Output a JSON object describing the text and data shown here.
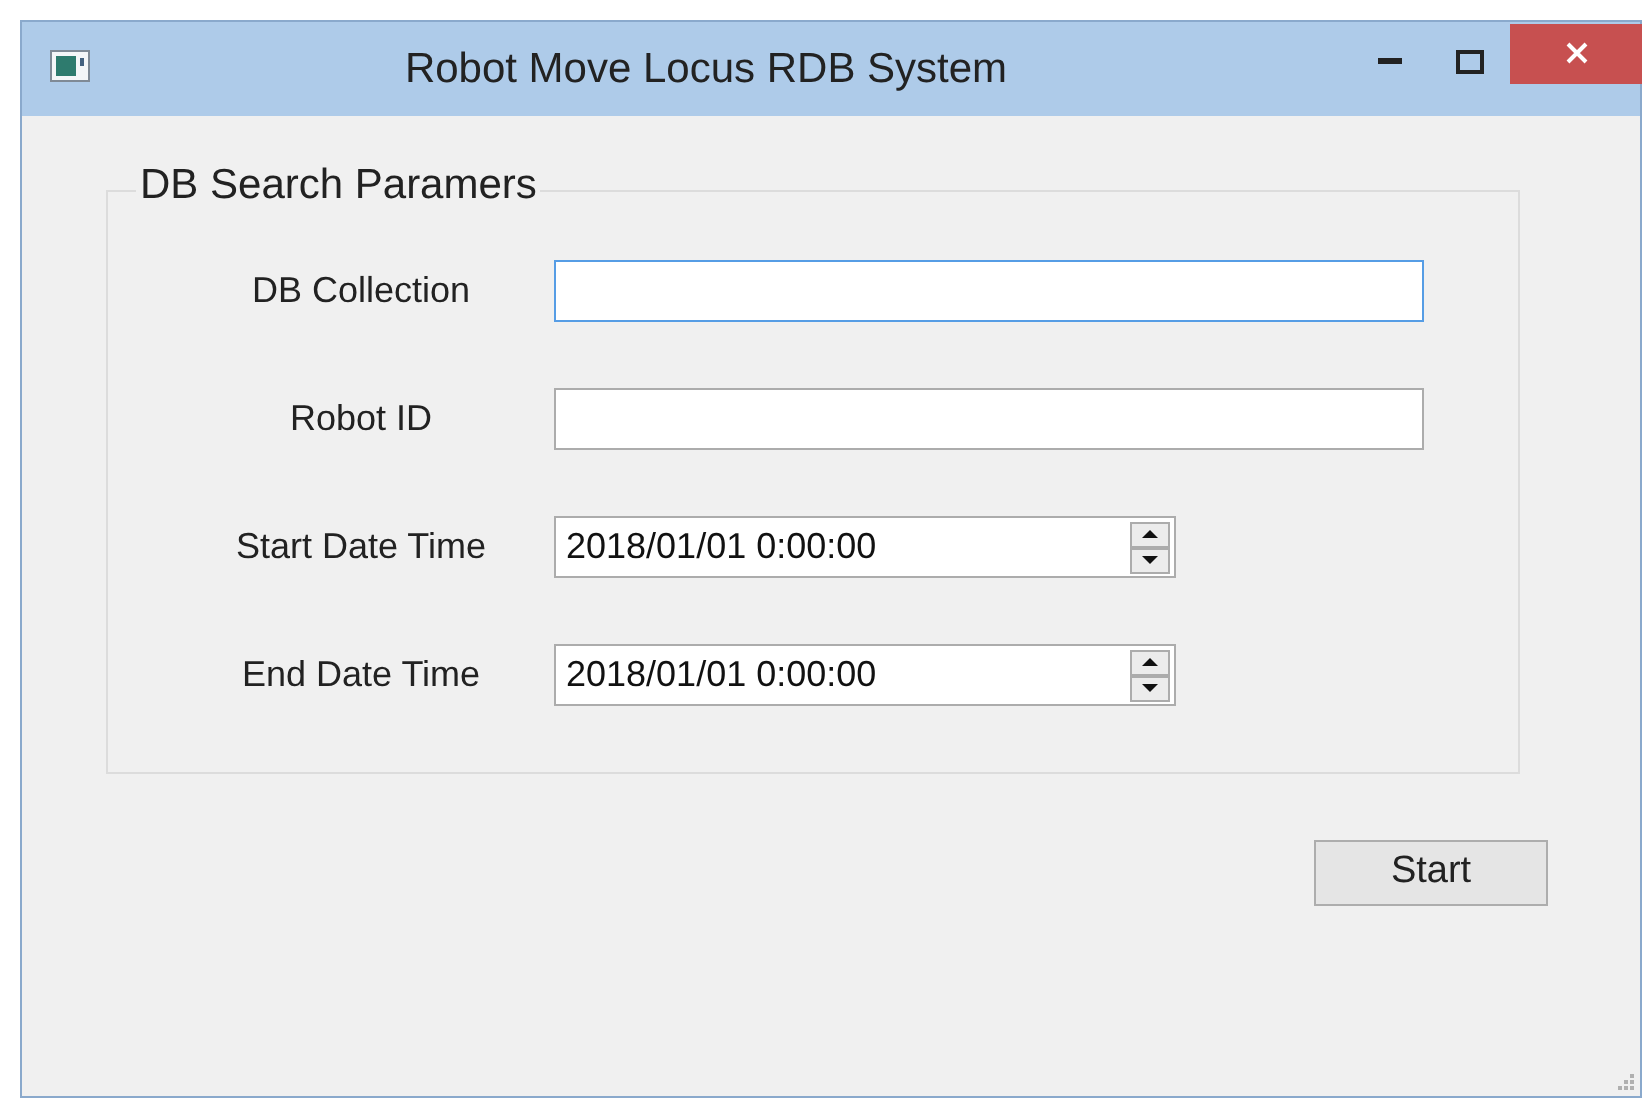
{
  "window": {
    "title": "Robot Move Locus RDB System"
  },
  "group": {
    "title": "DB Search Paramers",
    "fields": [
      {
        "label": "DB Collection",
        "kind": "text",
        "focused": true
      },
      {
        "label": "Robot ID",
        "kind": "text",
        "focused": false
      },
      {
        "label": "Start Date Time",
        "kind": "datetime",
        "value": "2018/01/01 0:00:00",
        "focused": false
      },
      {
        "label": "End Date Time",
        "kind": "datetime",
        "value": "2018/01/01 0:00:00",
        "focused": false
      }
    ]
  },
  "buttons": [
    "Start"
  ]
}
